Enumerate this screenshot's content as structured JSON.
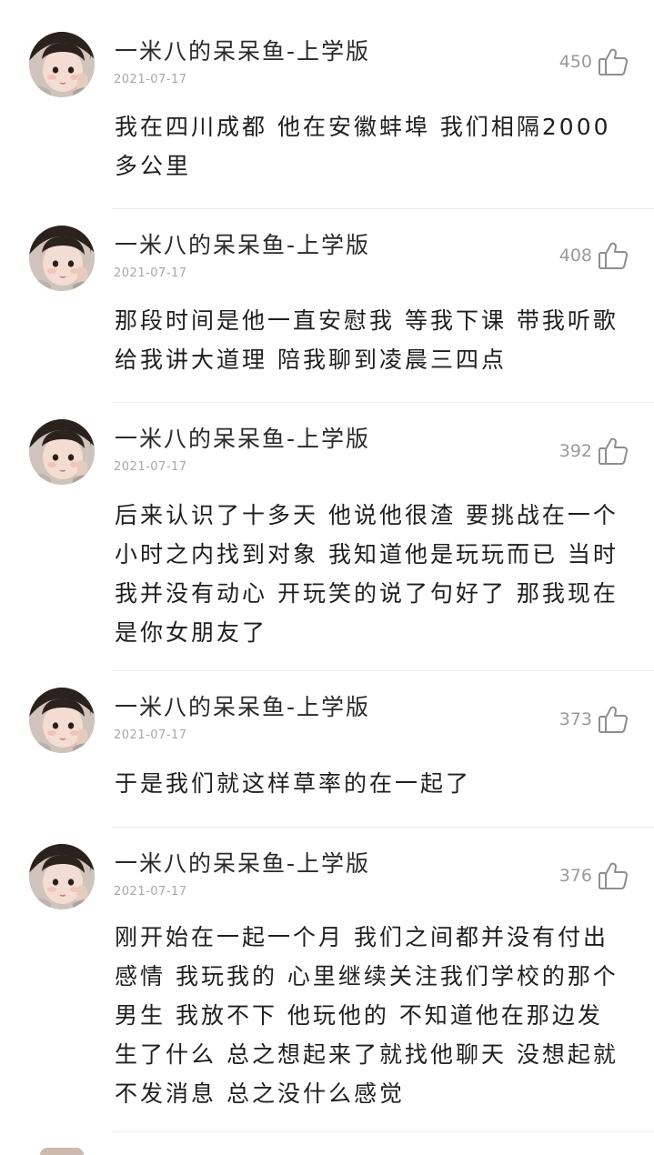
{
  "comments": [
    {
      "username": "一米八的呆呆鱼-上学版",
      "date": "2021-07-17",
      "likes": "450",
      "text": "我在四川成都 他在安徽蚌埠 我们相隔2000多公里"
    },
    {
      "username": "一米八的呆呆鱼-上学版",
      "date": "2021-07-17",
      "likes": "408",
      "text": "那段时间是他一直安慰我 等我下课 带我听歌 给我讲大道理 陪我聊到凌晨三四点"
    },
    {
      "username": "一米八的呆呆鱼-上学版",
      "date": "2021-07-17",
      "likes": "392",
      "text": "后来认识了十多天 他说他很渣 要挑战在一个小时之内找到对象 我知道他是玩玩而已 当时我并没有动心 开玩笑的说了句好了 那我现在是你女朋友了"
    },
    {
      "username": "一米八的呆呆鱼-上学版",
      "date": "2021-07-17",
      "likes": "373",
      "text": "于是我们就这样草率的在一起了"
    },
    {
      "username": "一米八的呆呆鱼-上学版",
      "date": "2021-07-17",
      "likes": "376",
      "text": "刚开始在一起一个月 我们之间都并没有付出感情 我玩我的 心里继续关注我们学校的那个男生 我放不下 他玩他的 不知道他在那边发生了什么 总之想起来了就找他聊天 没想起就不发消息 总之没什么感觉"
    }
  ],
  "icons": {
    "like": "thumbs-up-icon"
  }
}
